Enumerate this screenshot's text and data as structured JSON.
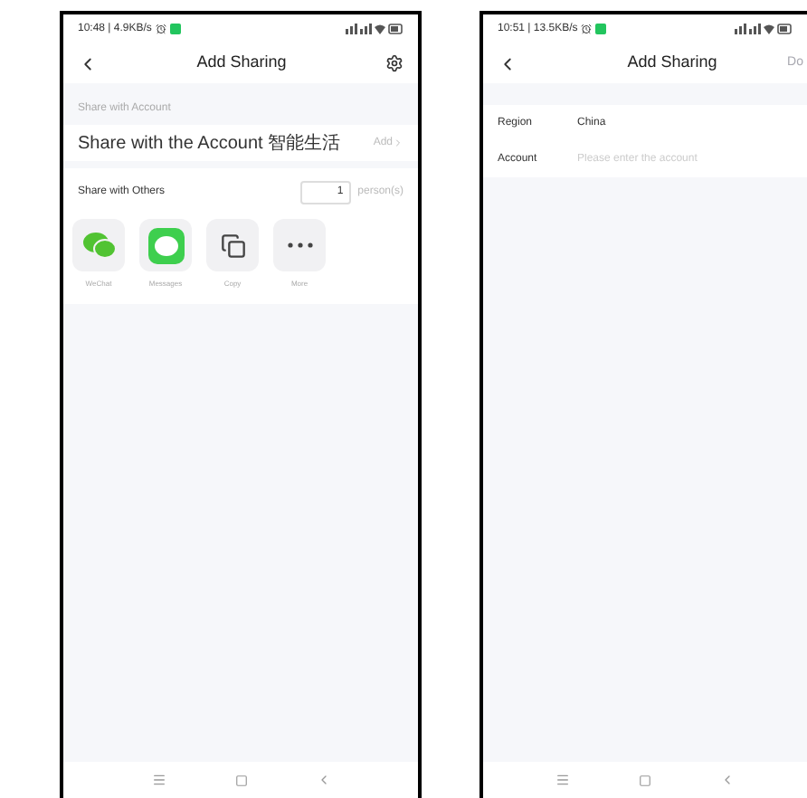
{
  "left_screen": {
    "status_time": "10:48 | 4.9KB/s",
    "title": "Add Sharing",
    "section": "Share with Account",
    "account_row": {
      "label": "Share with the Account 智能生活",
      "action": "Add"
    },
    "others_row": {
      "label": "Share with Others",
      "count": "1",
      "unit": "person(s)"
    },
    "share_targets": [
      {
        "kind": "wechat",
        "label": "WeChat"
      },
      {
        "kind": "messages",
        "label": "Messages"
      },
      {
        "kind": "copy",
        "label": "Copy"
      },
      {
        "kind": "more",
        "label": "More"
      }
    ]
  },
  "right_screen": {
    "status_time": "10:51 | 13.5KB/s",
    "title": "Add Sharing",
    "done": {
      "label": "Do",
      "disabled": true
    },
    "fields": [
      {
        "label": "Region",
        "value": "China"
      },
      {
        "label": "Account",
        "placeholder": "Please enter the account"
      }
    ]
  }
}
